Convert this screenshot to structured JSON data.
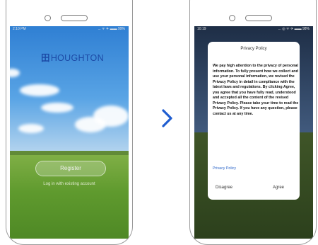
{
  "left_phone": {
    "status_time": "2:10 PM",
    "status_icons": "... ᯤ ✈ ▬▬ 99%",
    "logo_text": "HOUGHTON",
    "logo_mark": "田",
    "register_label": "Register",
    "login_link": "Log in with existing account"
  },
  "right_phone": {
    "status_time": "10:19",
    "status_icons": "... ◎ ᯤ ✈ ▬▬ 98%",
    "dialog": {
      "title": "Privacy Policy",
      "body": "We pay high attention to the privacy of personal information. To fully present how we collect and use your personal information, we revised the Privacy Policy in detail in compliance with the latest laws and regulations. By clicking Agree, you agree that you have fully read, understood and accepted all the content of the revised Privacy Policy. Please take your time to read the Privacy Policy. If you have any question, please contact us at any time.",
      "link": "Privacy Policy",
      "disagree_label": "Disagree",
      "agree_label": "Agree"
    }
  },
  "arrow_icon": "chevron-right-icon",
  "colors": {
    "brand": "#1c4aa6",
    "arrow": "#1f5dd0",
    "link": "#2a64c8"
  }
}
